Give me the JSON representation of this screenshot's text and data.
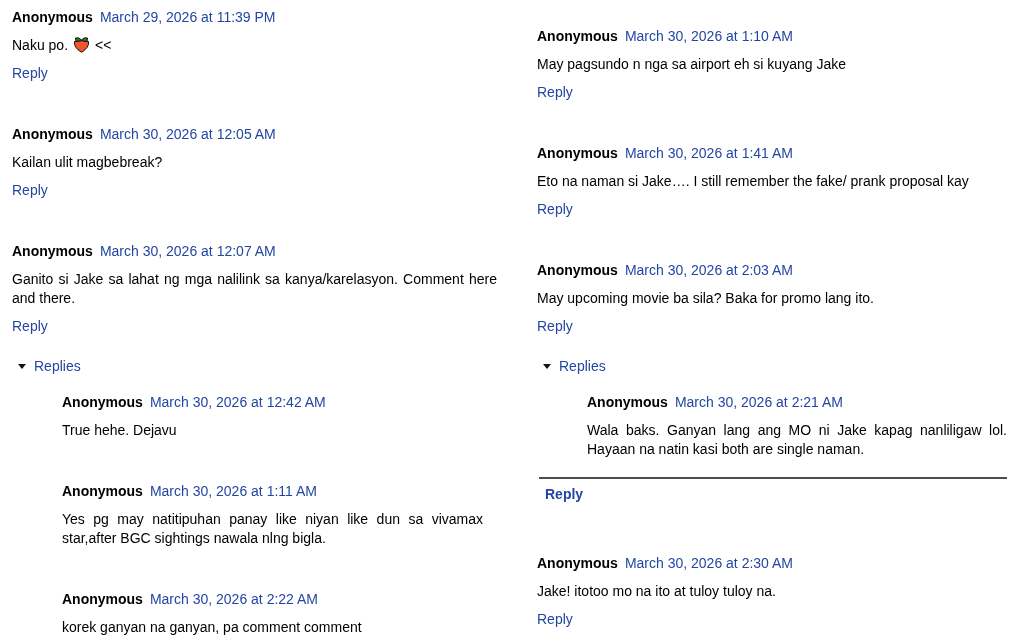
{
  "columns": [
    {
      "comments": [
        {
          "author": "Anonymous",
          "date": "March 29, 2026 at 11:39 PM",
          "body": [
            {
              "kind": "text",
              "text": "Naku po."
            },
            {
              "kind": "emoji"
            },
            {
              "kind": "text",
              "text": "<<"
            }
          ],
          "reply": "Reply"
        },
        {
          "author": "Anonymous",
          "date": "March 30, 2026 at 12:05 AM",
          "body": "Kailan ulit magbebreak?",
          "reply": "Reply"
        },
        {
          "author": "Anonymous",
          "date": "March 30, 2026 at 12:07 AM",
          "body": "Ganito si Jake sa lahat ng mga nalilink sa kanya/karelasyon. Comment here and there.",
          "reply": "Reply",
          "replies": {
            "toggle": "Replies",
            "expanded": true,
            "items": [
              {
                "author": "Anonymous",
                "date": "March 30, 2026 at 12:42 AM",
                "body": "True hehe. Dejavu"
              },
              {
                "author": "Anonymous",
                "date": "March 30, 2026 at 1:11 AM",
                "body": "Yes pg may natitipuhan panay like niyan like dun sa vivamax star,after BGC sightings nawala nlng bigla."
              },
              {
                "author": "Anonymous",
                "date": "March 30, 2026 at 2:22 AM",
                "body": "korek ganyan na ganyan, pa comment comment"
              }
            ]
          }
        }
      ]
    },
    {
      "comments": [
        {
          "author": "Anonymous",
          "date": "March 30, 2026 at 1:10 AM",
          "body": "May pagsundo n nga sa airport eh si kuyang Jake",
          "reply": "Reply"
        },
        {
          "author": "Anonymous",
          "date": "March 30, 2026 at 1:41 AM",
          "body": "Eto na naman si Jake…. I still remember the fake/ prank proposal kay",
          "reply": "Reply"
        },
        {
          "author": "Anonymous",
          "date": "March 30, 2026 at 2:03 AM",
          "body": "May upcoming movie ba sila? Baka for promo lang ito.",
          "reply": "Reply",
          "replies": {
            "toggle": "Replies",
            "expanded": true,
            "items": [
              {
                "author": "Anonymous",
                "date": "March 30, 2026 at 2:21 AM",
                "body": "Wala baks. Ganyan lang ang MO ni Jake kapag nanliligaw lol. Hayaan na natin kasi both are single naman."
              }
            ],
            "reply_button": "Reply"
          }
        },
        {
          "author": "Anonymous",
          "date": "March 30, 2026 at 2:30 AM",
          "body": "Jake! itotoo mo na ito at tuloy tuloy na.",
          "reply": "Reply"
        }
      ]
    }
  ]
}
